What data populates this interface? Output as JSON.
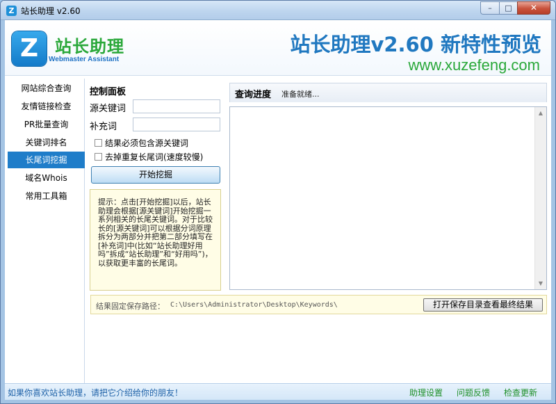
{
  "window": {
    "title": "站长助理 v2.60",
    "icon_letter": "Z",
    "min_glyph": "–",
    "max_glyph": "□",
    "close_glyph": "✕"
  },
  "header": {
    "logo_letter": "Z",
    "logo_cn": "站长助理",
    "logo_en": "Webmaster Assistant",
    "title": "站长助理v2.60 新特性预览",
    "url": "www.xuzefeng.com"
  },
  "sidebar": {
    "items": [
      {
        "label": "网站综合查询"
      },
      {
        "label": "友情链接检查"
      },
      {
        "label": "PR批量查询"
      },
      {
        "label": "关键词排名"
      },
      {
        "label": "长尾词挖掘"
      },
      {
        "label": "域名Whois"
      },
      {
        "label": "常用工具箱"
      }
    ],
    "active_index": 4
  },
  "control_panel": {
    "title": "控制面板",
    "source_keyword_label": "源关键词",
    "source_keyword_value": "",
    "supplement_label": "补充词",
    "supplement_value": "",
    "check1_label": "结果必须包含源关键词",
    "check2_label": "去掉重复长尾词(速度较慢)",
    "start_button": "开始挖掘",
    "tip": "提示：点击[开始挖掘]以后，站长助理会根据[源关键词]开始挖掘一系列相关的长尾关键词。对于比较长的[源关键词]可以根据分词原理拆分为两部分并把第二部分填写在[补充词]中(比如“站长助理好用吗”拆成“站长助理”和“好用吗”)，以获取更丰富的长尾词。"
  },
  "progress": {
    "label": "查询进度",
    "status": "准备就绪..."
  },
  "save": {
    "label": "结果固定保存路径：",
    "path": "C:\\Users\\Administrator\\Desktop\\Keywords\\",
    "open_button": "打开保存目录查看最终结果"
  },
  "footer": {
    "message": "如果你喜欢站长助理，请把它介绍给你的朋友！",
    "links": [
      {
        "label": "助理设置"
      },
      {
        "label": "问题反馈"
      },
      {
        "label": "检查更新"
      }
    ]
  },
  "colors": {
    "accent_blue": "#1f7dc9",
    "brand_green": "#2aa83a",
    "tip_background": "#fffde6"
  }
}
